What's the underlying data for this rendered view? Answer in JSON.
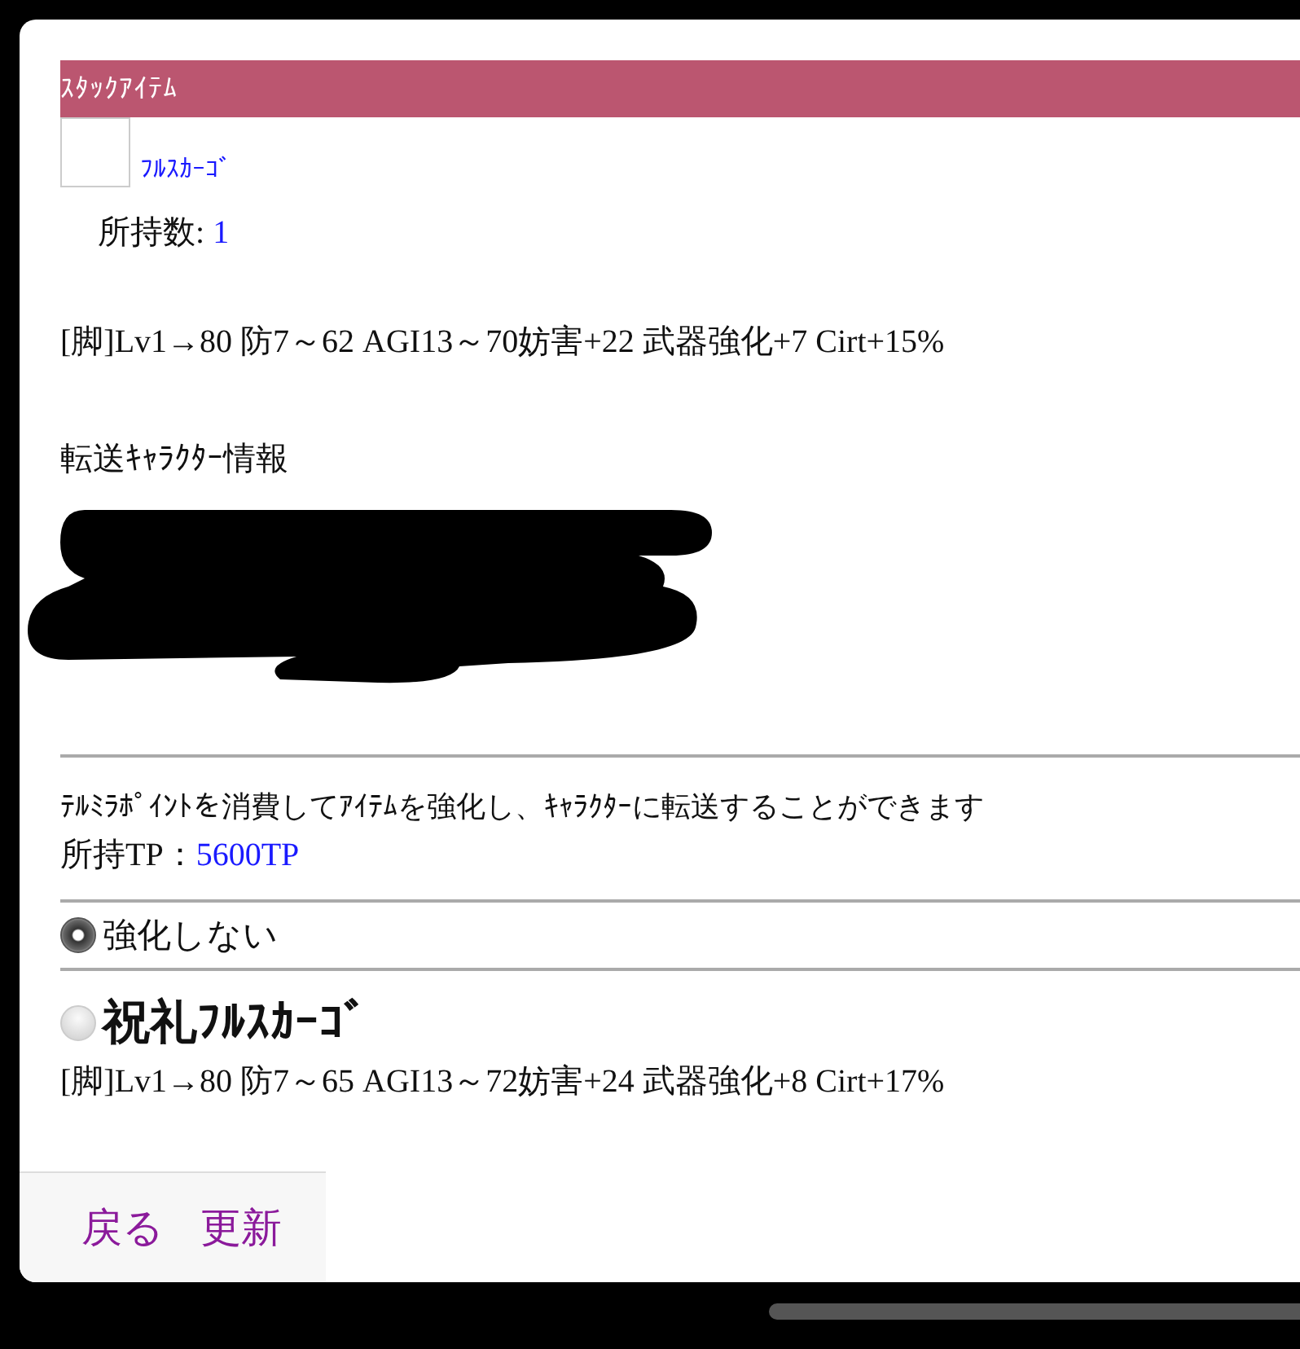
{
  "section_header": "ｽﾀｯｸｱｲﾃﾑ",
  "item": {
    "name": "ﾌﾙｽｶｰｺﾞ",
    "count_label": "所持数: ",
    "count": "1",
    "stats": "[脚]Lv1→80 防7～62 AGI13～70妨害+22 武器強化+7 Cirt+15%"
  },
  "transfer_heading": "転送ｷｬﾗｸﾀｰ情報",
  "description": "ﾃﾙﾐﾗﾎﾟｲﾝﾄを消費してｱｲﾃﾑを強化し、ｷｬﾗｸﾀｰに転送することができます",
  "tp": {
    "label": "所持TP：",
    "value": "5600TP"
  },
  "options": [
    {
      "kind": "plain",
      "label": "強化しない",
      "selected": true
    },
    {
      "kind": "upgrade",
      "label": "祝礼ﾌﾙｽｶｰｺﾞ",
      "stats": "[脚]Lv1→80 防7～65 AGI13～72妨害+24 武器強化+8 Cirt+17%",
      "selected": false
    }
  ],
  "footer_links": [
    "戻る",
    "更新"
  ]
}
